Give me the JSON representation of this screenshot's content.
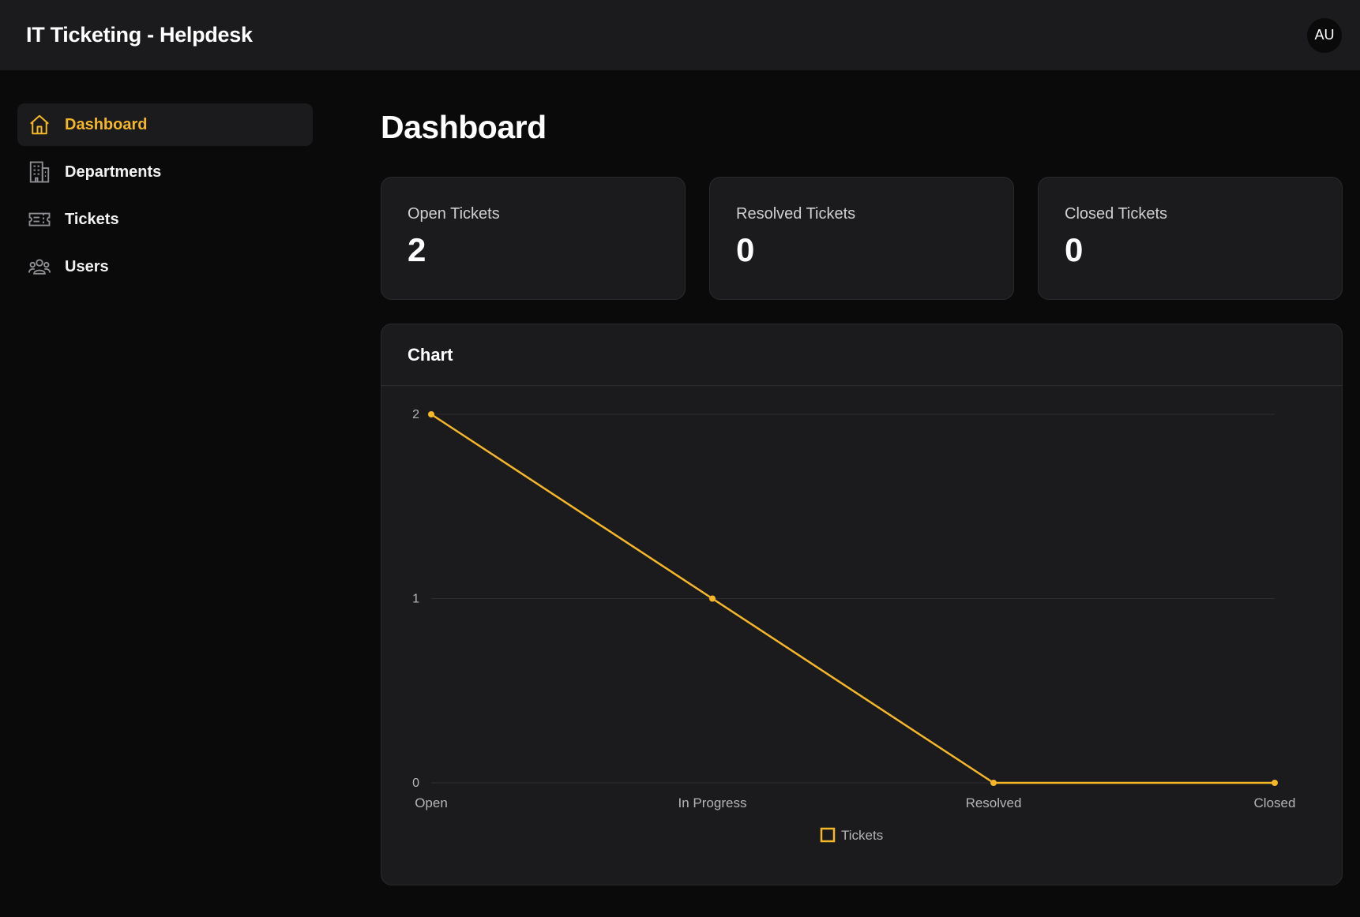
{
  "app": {
    "title": "IT Ticketing - Helpdesk",
    "user_initials": "AU"
  },
  "sidebar": {
    "items": [
      {
        "label": "Dashboard",
        "icon": "home-icon",
        "active": true
      },
      {
        "label": "Departments",
        "icon": "building-icon",
        "active": false
      },
      {
        "label": "Tickets",
        "icon": "ticket-icon",
        "active": false
      },
      {
        "label": "Users",
        "icon": "users-icon",
        "active": false
      }
    ]
  },
  "main": {
    "title": "Dashboard",
    "stats": [
      {
        "label": "Open Tickets",
        "value": "2"
      },
      {
        "label": "Resolved Tickets",
        "value": "0"
      },
      {
        "label": "Closed Tickets",
        "value": "0"
      }
    ],
    "chart_card": {
      "title": "Chart"
    }
  },
  "colors": {
    "accent": "#f4b728",
    "card": "#1b1b1d",
    "background": "#0a0a0b"
  },
  "chart_data": {
    "type": "line",
    "categories": [
      "Open",
      "In Progress",
      "Resolved",
      "Closed"
    ],
    "series": [
      {
        "name": "Tickets",
        "values": [
          2,
          1,
          0,
          0
        ]
      }
    ],
    "yticks": [
      "0",
      "1",
      "2"
    ],
    "ylim": [
      0,
      2
    ],
    "grid": true,
    "legend": "bottom",
    "color": "#f4b728"
  }
}
